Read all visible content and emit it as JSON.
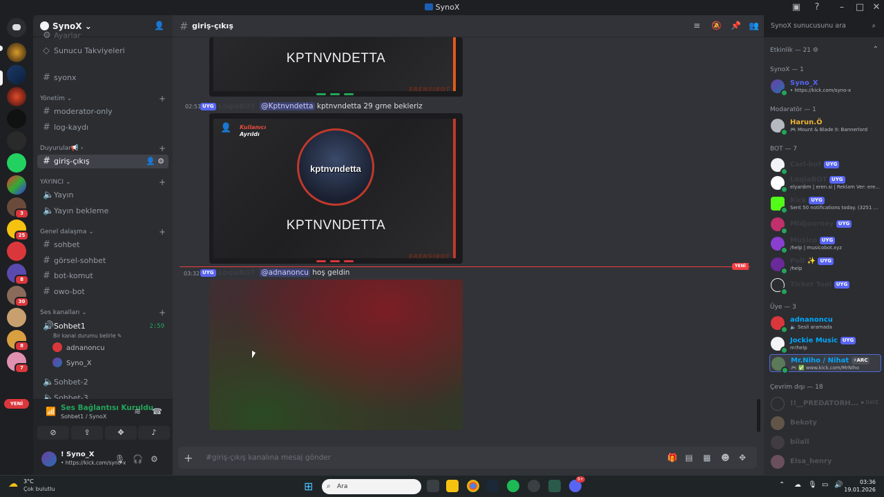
{
  "window": {
    "title": "SynoX"
  },
  "server": {
    "name": "SynoX"
  },
  "sidebar": {
    "partial_top": "Ayarlar",
    "items": [
      {
        "label": "Sunucu Takviyeleri",
        "icon": "boost-icon"
      },
      {
        "label": "syonx",
        "icon": "hash-icon"
      }
    ],
    "categories": {
      "yonetim": "Yönetim",
      "duyurular": "Duyurular📢",
      "yayinci": "YAYINCI",
      "genel": "Genel dalaşma",
      "ses": "Ses kanalları"
    },
    "channels": {
      "moderator": "moderator-only",
      "log": "log-kaydı",
      "giris": "giriş-çıkış",
      "yayin": "Yayın",
      "yayin_bekleme": "Yayın bekleme",
      "sohbet": "sohbet",
      "gorsel": "görsel-sohbet",
      "bot": "bot-komut",
      "owo": "owo-bot",
      "sohbet1": "Sohbet1",
      "sohbet1_time": "2:59",
      "sohbet1_status": "Bir kanal durumu belirle",
      "sohbet2": "Sohbet-2",
      "sohbet3": "Sohbet-3"
    },
    "voice_users": [
      "adnanoncu",
      "Syno_X"
    ]
  },
  "voice_panel": {
    "title": "Ses Bağlantısı Kuruldu",
    "subtitle": "Sohbet1 / SynoX"
  },
  "user_panel": {
    "name": "! Syno_X",
    "status": "• https://kick.com/syno-x"
  },
  "rail": {
    "badges": [
      "3",
      "25",
      "8",
      "30",
      "8",
      "7"
    ],
    "new_label": "YENİ"
  },
  "channel_header": {
    "name": "giriş-çıkış"
  },
  "messages": [
    {
      "time": "02:51",
      "tag": "UYG",
      "author": "LoqiaBOT",
      "mention": "@Kptnvndetta",
      "text": "kptnvndetta  29 grne bekleriz"
    },
    {
      "time": "03:32",
      "tag": "UYG",
      "author": "LoqiaBOT",
      "mention": "@adnanoncu",
      "text": "hoş geldin"
    }
  ],
  "cards": {
    "name": "KPTNVNDETTA",
    "watermark": "ERENSIBOT",
    "badge_top": "Kullanıcı",
    "badge_bottom": "Ayrıldı",
    "avatar_label": "kptnvndetta"
  },
  "new_divider": "YENİ",
  "input": {
    "placeholder": "#giriş-çıkış kanalına mesaj gönder"
  },
  "search": {
    "placeholder": "SynoX sunucusunu ara"
  },
  "members": {
    "activity": "Etkinlik — 21",
    "groups": [
      {
        "label": "SynoX — 1"
      },
      {
        "label": "Modaratör — 1"
      },
      {
        "label": "BOT — 7"
      },
      {
        "label": "Üye — 3"
      },
      {
        "label": "Çevrim dışı — 18"
      }
    ],
    "synox": [
      {
        "name": "Syno_X",
        "status": "• https://kick.com/syno-x",
        "color": "#5865f2"
      }
    ],
    "mods": [
      {
        "name": "Harun.Ö",
        "status": "Mount & Blade II: Bannerlord",
        "color": "#f0b232"
      }
    ],
    "bots": [
      {
        "name": "Carl-bot",
        "tag": "UYG",
        "status": ""
      },
      {
        "name": "LoqiaBOT",
        "tag": "UYG",
        "status": "elyardım | eren.si | Reklam Ver: ere..."
      },
      {
        "name": "Kick",
        "tag": "UYG",
        "status": "Sent 50 notifications today. (3251 ..."
      },
      {
        "name": "Midjourney",
        "tag": "UYG",
        "status": ""
      },
      {
        "name": "Musico",
        "tag": "UYG",
        "status": "/help | musicobot.xyz"
      },
      {
        "name": "Poll",
        "tag": "UYG",
        "status": "/help"
      },
      {
        "name": "Ticket Tool",
        "tag": "UYG",
        "status": ""
      }
    ],
    "users": [
      {
        "name": "adnanoncu",
        "status": "Sesli aramada"
      },
      {
        "name": "Jockie Music",
        "tag": "UYG",
        "status": "m!help"
      },
      {
        "name": "Mr.Niho / Nihat",
        "tag": "ARC",
        "status": "www.kick.com/MrNiho"
      }
    ],
    "offline": [
      {
        "name": "!!__PREDATORH...",
        "tag": "DAYZ"
      },
      {
        "name": "Bekoty"
      },
      {
        "name": "bilall"
      },
      {
        "name": "Elsa_henry"
      }
    ]
  },
  "taskbar": {
    "weather_temp": "3°C",
    "weather_desc": "Çok bulutlu",
    "search": "Ara",
    "time": "03:36",
    "date": "19.01.2026",
    "discord_badge": "9+"
  }
}
